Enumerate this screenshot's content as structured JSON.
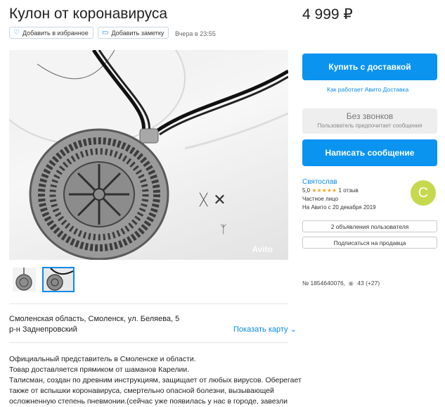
{
  "listing": {
    "title": "Кулон от коронавируса",
    "price": "4 999 ₽",
    "favorite_label": "Добавить в избранное",
    "note_label": "Добавить заметку",
    "date": "Вчера в 23:55",
    "watermark": "Avito"
  },
  "location": {
    "address": "Смоленская область, Смоленск, ул. Беляева, 5",
    "district": "р-н Заднепровский",
    "show_map": "Показать карту"
  },
  "description": {
    "lines": [
      "Официальный представитель в Смоленске и области.",
      "Товар доставляется прямиком от шаманов Карелии.",
      "Талисман, создан по древним инструкциям, защищает от любых вирусов. Оберегает",
      "также от вспышки коронавируса, смертельно опасной болезни, вызывающей",
      "осложненную степень пневмонии.(сейчас уже появилась у нас в городе, завезли"
    ]
  },
  "actions": {
    "buy_label": "Купить с доставкой",
    "delivery_link": "Как работает Авито Доставка",
    "no_calls_title": "Без звонков",
    "no_calls_sub": "Пользователь предпочитает сообщения",
    "message_label": "Написать сообщение"
  },
  "seller": {
    "name": "Святослав",
    "rating": "5,0",
    "stars": "★★★★★",
    "reviews": "1 отзыв",
    "type": "Частное лицо",
    "since": "На Авито с 20 декабря 2019",
    "avatar_letter": "С",
    "ads_label": "2 объявления пользователя",
    "subscribe_label": "Подписаться на продавца"
  },
  "stats": {
    "ad_number": "№ 1854640076,",
    "views": "43 (+27)"
  },
  "colors": {
    "accent": "#0a94f0",
    "link": "#0a8ae8",
    "avatar": "#c6d84e",
    "star": "#f5a623"
  }
}
